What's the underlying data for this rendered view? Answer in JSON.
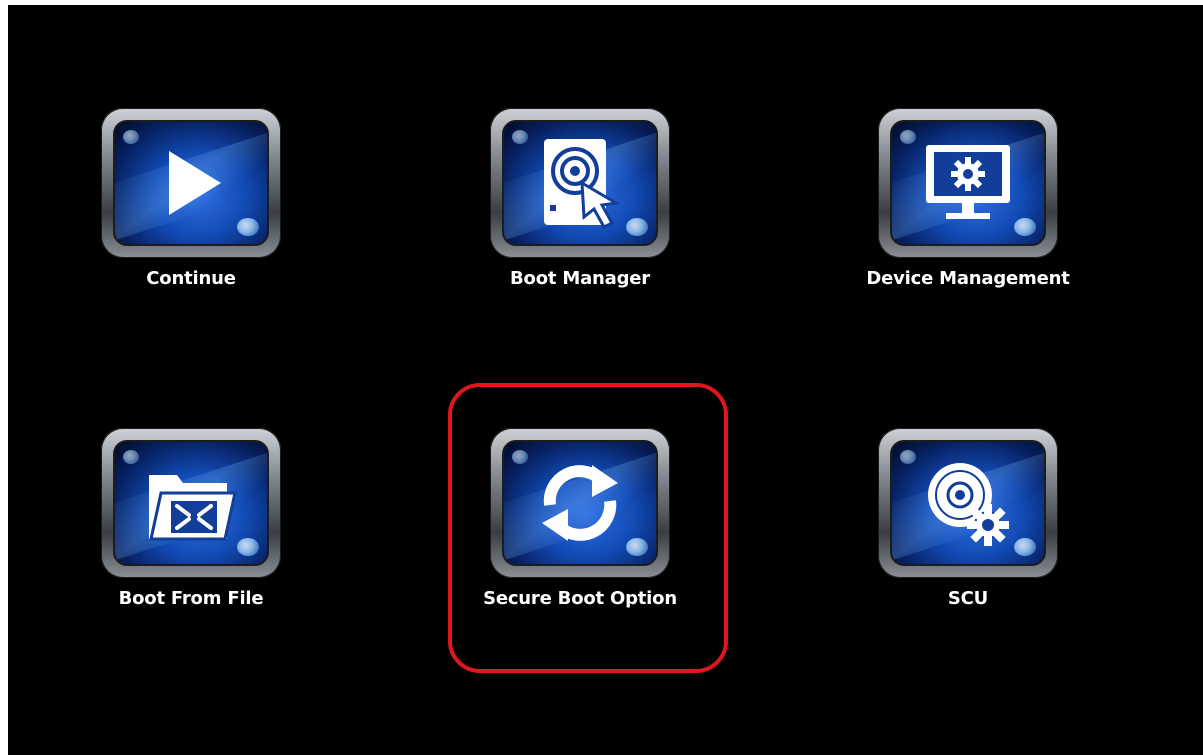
{
  "menu": {
    "items": [
      {
        "label": "Continue",
        "icon": "play-icon"
      },
      {
        "label": "Boot Manager",
        "icon": "disk-pointer-icon"
      },
      {
        "label": "Device Management",
        "icon": "monitor-gear-icon"
      },
      {
        "label": "Boot From File",
        "icon": "folder-arrows-icon"
      },
      {
        "label": "Secure Boot Option",
        "icon": "refresh-arrows-icon"
      },
      {
        "label": "SCU",
        "icon": "disc-gear-icon"
      }
    ],
    "highlighted_item": "Secure Boot Option"
  },
  "colors": {
    "background": "#000000",
    "tile_blue": "#124bb5",
    "highlight_border": "#e0161d",
    "label_text": "#ffffff"
  }
}
